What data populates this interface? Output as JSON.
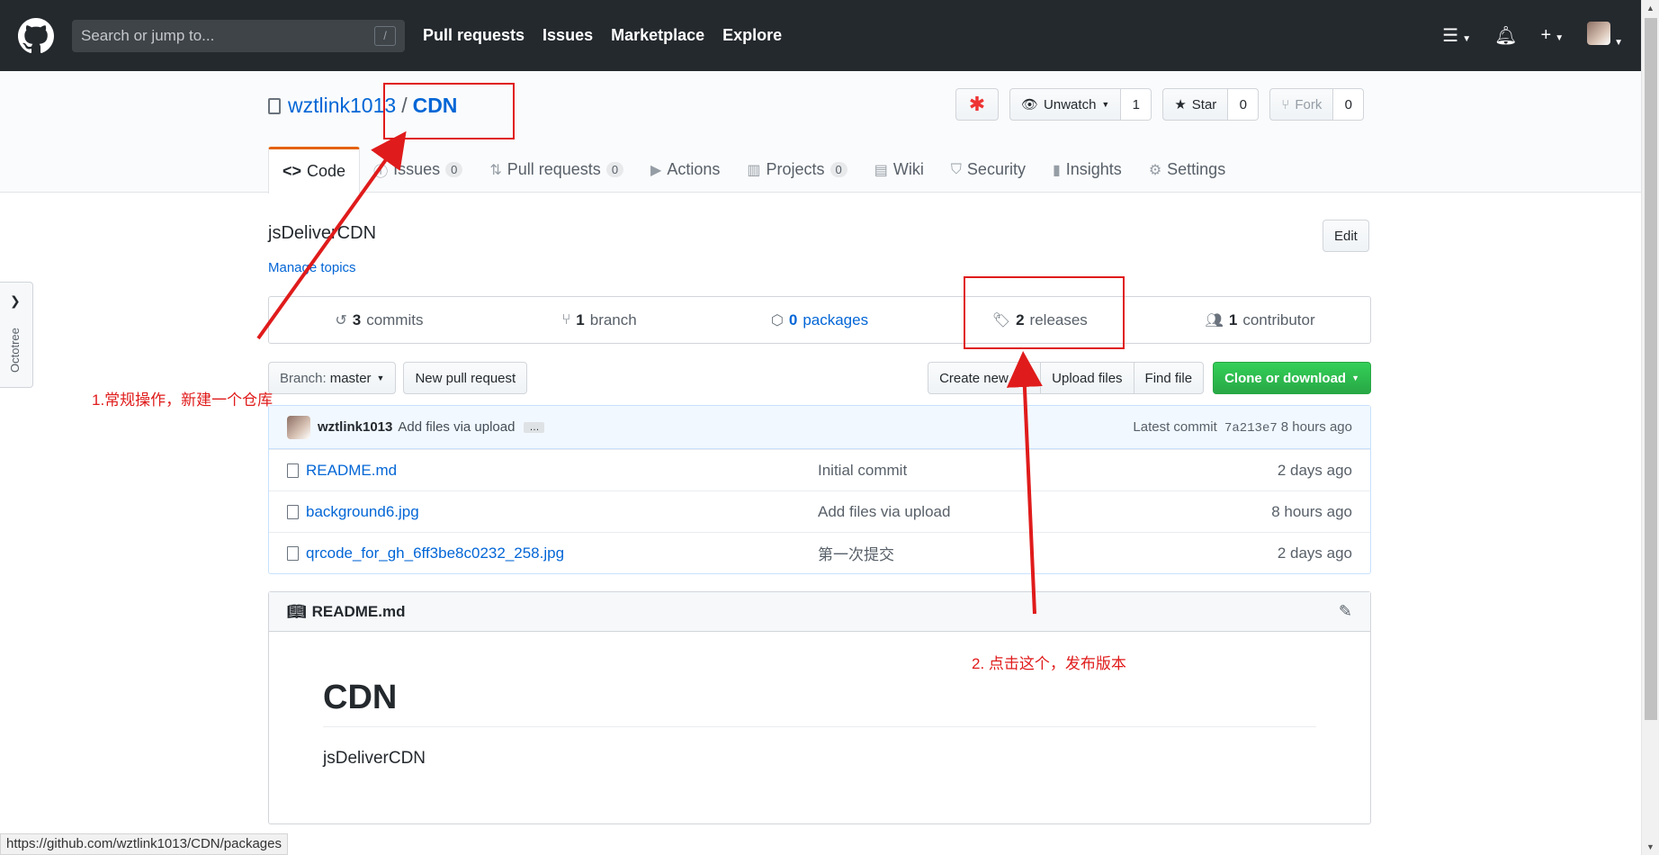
{
  "header": {
    "search_placeholder": "Search or jump to...",
    "search_shortcut": "/",
    "nav": [
      "Pull requests",
      "Issues",
      "Marketplace",
      "Explore"
    ]
  },
  "repo": {
    "owner": "wztlink1013",
    "separator": "/",
    "name": "CDN",
    "unwatch_label": "Unwatch",
    "watch_count": "1",
    "star_label": "Star",
    "star_count": "0",
    "fork_label": "Fork",
    "fork_count": "0"
  },
  "tabs": [
    {
      "label": "Code"
    },
    {
      "label": "Issues",
      "count": "0"
    },
    {
      "label": "Pull requests",
      "count": "0"
    },
    {
      "label": "Actions"
    },
    {
      "label": "Projects",
      "count": "0"
    },
    {
      "label": "Wiki"
    },
    {
      "label": "Security"
    },
    {
      "label": "Insights"
    },
    {
      "label": "Settings"
    }
  ],
  "summary": {
    "description": "jsDeliverCDN",
    "manage_topics": "Manage topics",
    "edit_label": "Edit"
  },
  "numbers": {
    "commits_num": "3",
    "commits_label": "commits",
    "branch_num": "1",
    "branch_label": "branch",
    "packages_num": "0",
    "packages_label": "packages",
    "releases_num": "2",
    "releases_label": "releases",
    "contributor_num": "1",
    "contributor_label": "contributor"
  },
  "filenav": {
    "branch_prefix": "Branch:",
    "branch_name": "master",
    "new_pr": "New pull request",
    "create_file": "Create new file",
    "upload_files": "Upload files",
    "find_file": "Find file",
    "clone": "Clone or download"
  },
  "commit": {
    "author": "wztlink1013",
    "message": "Add files via upload",
    "dots": "…",
    "latest_label": "Latest commit",
    "sha": "7a213e7",
    "age": "8 hours ago"
  },
  "files": [
    {
      "name": "README.md",
      "message": "Initial commit",
      "age": "2 days ago"
    },
    {
      "name": "background6.jpg",
      "message": "Add files via upload",
      "age": "8 hours ago"
    },
    {
      "name": "qrcode_for_gh_6ff3be8c0232_258.jpg",
      "message": "第一次提交",
      "age": "2 days ago"
    }
  ],
  "readme": {
    "filename": "README.md",
    "heading": "CDN",
    "body": "jsDeliverCDN"
  },
  "octotree": {
    "label": "Octotree"
  },
  "statusbar": {
    "url": "https://github.com/wztlink1013/CDN/packages"
  },
  "annotations": {
    "note1": "1.常规操作，新建一个仓库",
    "note2": "2. 点击这个，发布版本",
    "color": "#e01b1b"
  },
  "colors": {
    "header_bg": "#24292e",
    "link": "#0366d6",
    "green": "#28a745",
    "tab_accent": "#e36209"
  }
}
